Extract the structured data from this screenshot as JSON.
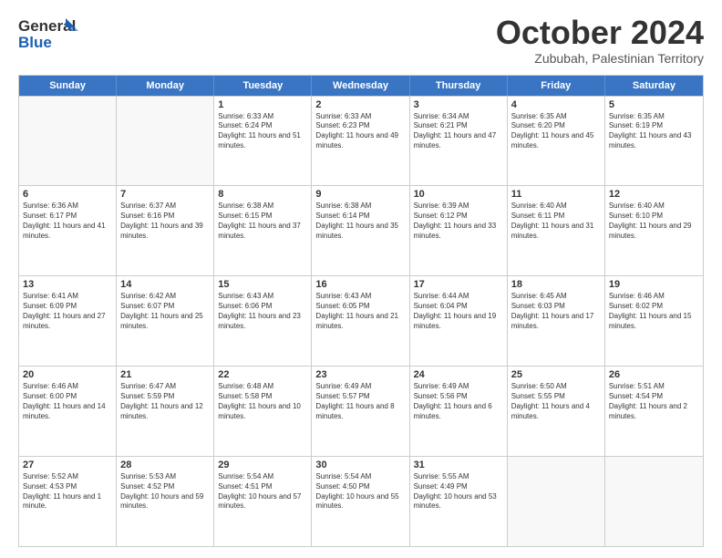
{
  "logo": {
    "line1": "General",
    "line2": "Blue"
  },
  "title": "October 2024",
  "location": "Zububah, Palestinian Territory",
  "days": [
    "Sunday",
    "Monday",
    "Tuesday",
    "Wednesday",
    "Thursday",
    "Friday",
    "Saturday"
  ],
  "weeks": [
    [
      {
        "num": "",
        "info": ""
      },
      {
        "num": "",
        "info": ""
      },
      {
        "num": "1",
        "info": "Sunrise: 6:33 AM\nSunset: 6:24 PM\nDaylight: 11 hours and 51 minutes."
      },
      {
        "num": "2",
        "info": "Sunrise: 6:33 AM\nSunset: 6:23 PM\nDaylight: 11 hours and 49 minutes."
      },
      {
        "num": "3",
        "info": "Sunrise: 6:34 AM\nSunset: 6:21 PM\nDaylight: 11 hours and 47 minutes."
      },
      {
        "num": "4",
        "info": "Sunrise: 6:35 AM\nSunset: 6:20 PM\nDaylight: 11 hours and 45 minutes."
      },
      {
        "num": "5",
        "info": "Sunrise: 6:35 AM\nSunset: 6:19 PM\nDaylight: 11 hours and 43 minutes."
      }
    ],
    [
      {
        "num": "6",
        "info": "Sunrise: 6:36 AM\nSunset: 6:17 PM\nDaylight: 11 hours and 41 minutes."
      },
      {
        "num": "7",
        "info": "Sunrise: 6:37 AM\nSunset: 6:16 PM\nDaylight: 11 hours and 39 minutes."
      },
      {
        "num": "8",
        "info": "Sunrise: 6:38 AM\nSunset: 6:15 PM\nDaylight: 11 hours and 37 minutes."
      },
      {
        "num": "9",
        "info": "Sunrise: 6:38 AM\nSunset: 6:14 PM\nDaylight: 11 hours and 35 minutes."
      },
      {
        "num": "10",
        "info": "Sunrise: 6:39 AM\nSunset: 6:12 PM\nDaylight: 11 hours and 33 minutes."
      },
      {
        "num": "11",
        "info": "Sunrise: 6:40 AM\nSunset: 6:11 PM\nDaylight: 11 hours and 31 minutes."
      },
      {
        "num": "12",
        "info": "Sunrise: 6:40 AM\nSunset: 6:10 PM\nDaylight: 11 hours and 29 minutes."
      }
    ],
    [
      {
        "num": "13",
        "info": "Sunrise: 6:41 AM\nSunset: 6:09 PM\nDaylight: 11 hours and 27 minutes."
      },
      {
        "num": "14",
        "info": "Sunrise: 6:42 AM\nSunset: 6:07 PM\nDaylight: 11 hours and 25 minutes."
      },
      {
        "num": "15",
        "info": "Sunrise: 6:43 AM\nSunset: 6:06 PM\nDaylight: 11 hours and 23 minutes."
      },
      {
        "num": "16",
        "info": "Sunrise: 6:43 AM\nSunset: 6:05 PM\nDaylight: 11 hours and 21 minutes."
      },
      {
        "num": "17",
        "info": "Sunrise: 6:44 AM\nSunset: 6:04 PM\nDaylight: 11 hours and 19 minutes."
      },
      {
        "num": "18",
        "info": "Sunrise: 6:45 AM\nSunset: 6:03 PM\nDaylight: 11 hours and 17 minutes."
      },
      {
        "num": "19",
        "info": "Sunrise: 6:46 AM\nSunset: 6:02 PM\nDaylight: 11 hours and 15 minutes."
      }
    ],
    [
      {
        "num": "20",
        "info": "Sunrise: 6:46 AM\nSunset: 6:00 PM\nDaylight: 11 hours and 14 minutes."
      },
      {
        "num": "21",
        "info": "Sunrise: 6:47 AM\nSunset: 5:59 PM\nDaylight: 11 hours and 12 minutes."
      },
      {
        "num": "22",
        "info": "Sunrise: 6:48 AM\nSunset: 5:58 PM\nDaylight: 11 hours and 10 minutes."
      },
      {
        "num": "23",
        "info": "Sunrise: 6:49 AM\nSunset: 5:57 PM\nDaylight: 11 hours and 8 minutes."
      },
      {
        "num": "24",
        "info": "Sunrise: 6:49 AM\nSunset: 5:56 PM\nDaylight: 11 hours and 6 minutes."
      },
      {
        "num": "25",
        "info": "Sunrise: 6:50 AM\nSunset: 5:55 PM\nDaylight: 11 hours and 4 minutes."
      },
      {
        "num": "26",
        "info": "Sunrise: 5:51 AM\nSunset: 4:54 PM\nDaylight: 11 hours and 2 minutes."
      }
    ],
    [
      {
        "num": "27",
        "info": "Sunrise: 5:52 AM\nSunset: 4:53 PM\nDaylight: 11 hours and 1 minute."
      },
      {
        "num": "28",
        "info": "Sunrise: 5:53 AM\nSunset: 4:52 PM\nDaylight: 10 hours and 59 minutes."
      },
      {
        "num": "29",
        "info": "Sunrise: 5:54 AM\nSunset: 4:51 PM\nDaylight: 10 hours and 57 minutes."
      },
      {
        "num": "30",
        "info": "Sunrise: 5:54 AM\nSunset: 4:50 PM\nDaylight: 10 hours and 55 minutes."
      },
      {
        "num": "31",
        "info": "Sunrise: 5:55 AM\nSunset: 4:49 PM\nDaylight: 10 hours and 53 minutes."
      },
      {
        "num": "",
        "info": ""
      },
      {
        "num": "",
        "info": ""
      }
    ]
  ]
}
